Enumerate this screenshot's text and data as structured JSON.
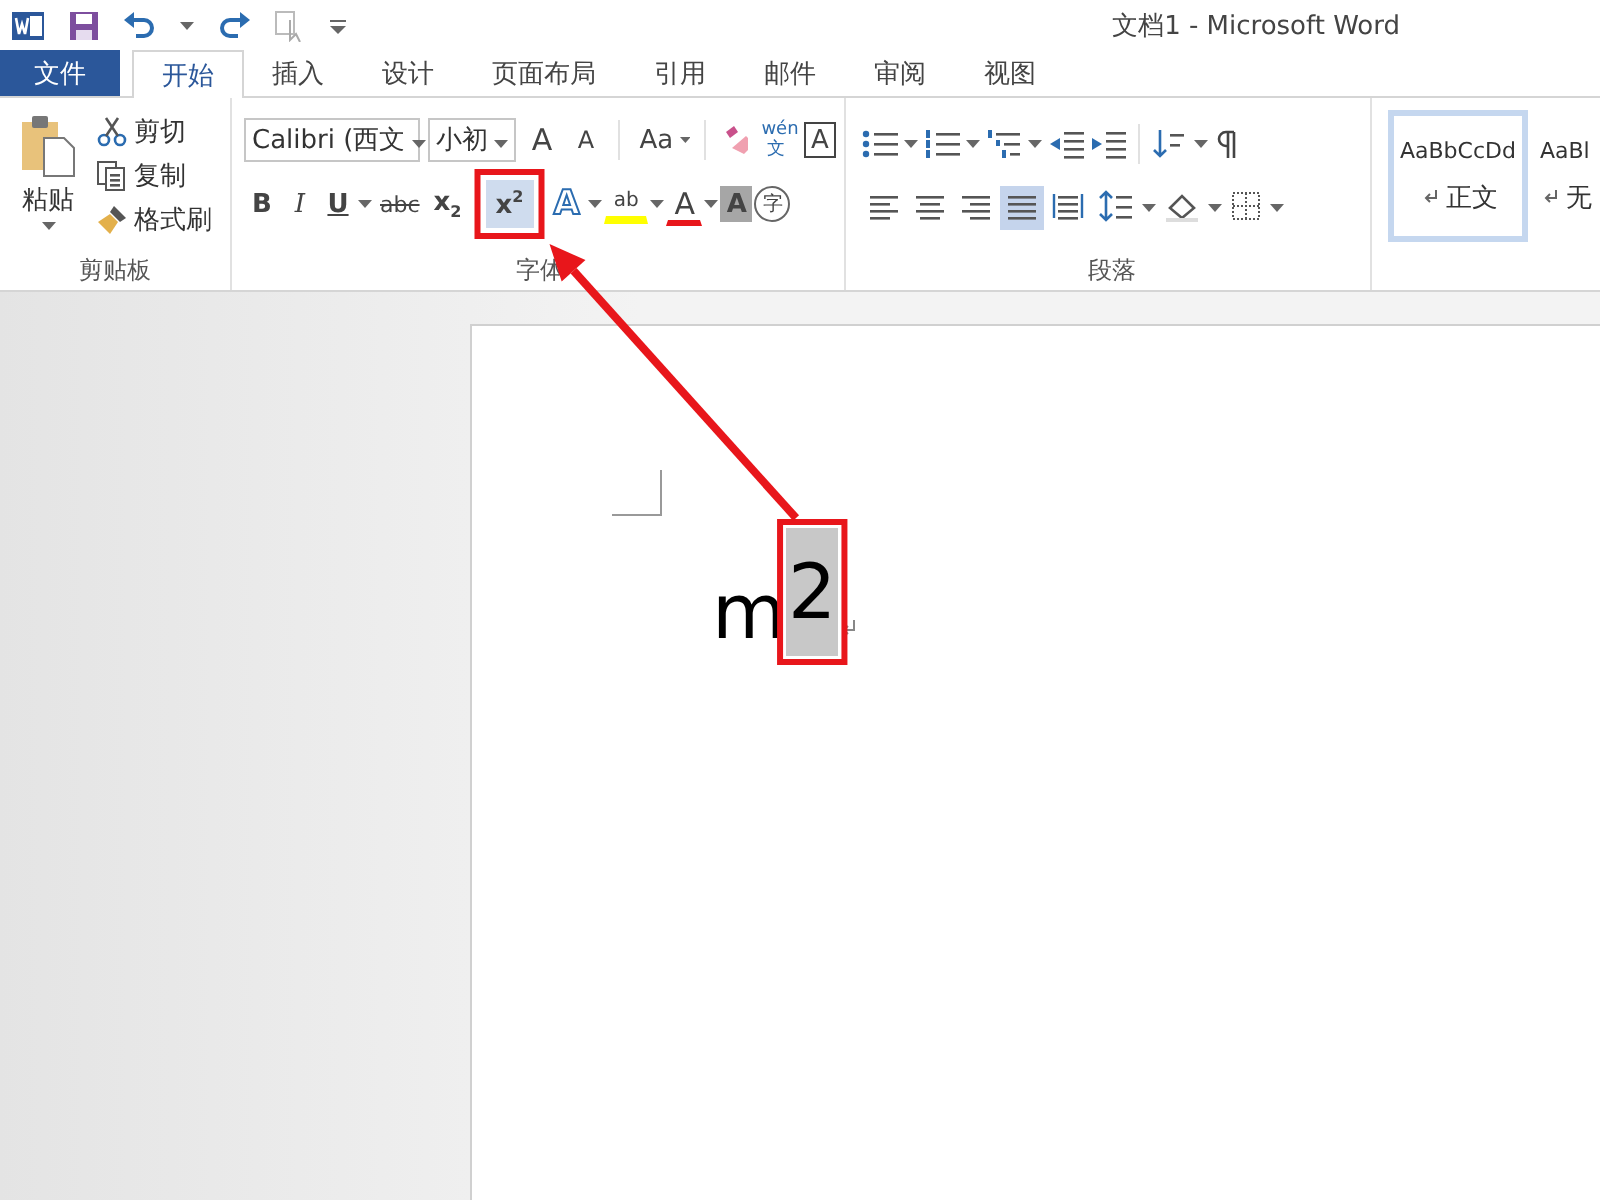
{
  "window": {
    "title": "文档1 - Microsoft Word"
  },
  "tabs": [
    {
      "label": "文件",
      "kind": "file",
      "selected": false
    },
    {
      "label": "开始",
      "kind": "tab",
      "selected": true
    },
    {
      "label": "插入",
      "kind": "tab",
      "selected": false
    },
    {
      "label": "设计",
      "kind": "tab",
      "selected": false
    },
    {
      "label": "页面布局",
      "kind": "tab",
      "selected": false
    },
    {
      "label": "引用",
      "kind": "tab",
      "selected": false
    },
    {
      "label": "邮件",
      "kind": "tab",
      "selected": false
    },
    {
      "label": "审阅",
      "kind": "tab",
      "selected": false
    },
    {
      "label": "视图",
      "kind": "tab",
      "selected": false
    }
  ],
  "clipboard": {
    "paste": "粘贴",
    "items": [
      {
        "kind": "cut",
        "label": "剪切"
      },
      {
        "kind": "copy",
        "label": "复制"
      },
      {
        "kind": "painter",
        "label": "格式刷"
      }
    ],
    "label": "剪贴板"
  },
  "font": {
    "name": "Calibri (西文",
    "size": "小初",
    "label": "字体",
    "row1": [
      {
        "kind": "grow",
        "label": "A"
      },
      {
        "kind": "shrink",
        "label": "A"
      },
      {
        "kind": "case",
        "label": "Aa"
      },
      {
        "kind": "clear"
      },
      {
        "kind": "phonetic",
        "label": "wén",
        "sub": "文"
      },
      {
        "kind": "border",
        "label": "A"
      }
    ],
    "row2": [
      {
        "kind": "bold",
        "label": "B",
        "selected": false
      },
      {
        "kind": "italic",
        "label": "I",
        "selected": false
      },
      {
        "kind": "underline",
        "label": "U",
        "selected": false
      },
      {
        "kind": "strike",
        "label": "abc",
        "selected": false
      },
      {
        "kind": "subscript",
        "label": "x$_{2}$",
        "selected": false
      },
      {
        "kind": "superscript",
        "label": "x$^{2}$",
        "selected": true
      },
      {
        "kind": "effects",
        "label": "A",
        "selected": false
      },
      {
        "kind": "highlight",
        "label": "ab",
        "selected": false
      },
      {
        "kind": "color",
        "label": "A",
        "selected": false
      },
      {
        "kind": "shading",
        "label": "A",
        "selected": false
      },
      {
        "kind": "enclose",
        "label": "字",
        "selected": false
      }
    ]
  },
  "paragraph": {
    "label": "段落",
    "row1": [
      {
        "kind": "bullets"
      },
      {
        "kind": "numbering"
      },
      {
        "kind": "multilevel"
      },
      {
        "kind": "outdent"
      },
      {
        "kind": "indent"
      },
      {
        "kind": "sort"
      },
      {
        "kind": "marks"
      }
    ],
    "row2": [
      {
        "kind": "left",
        "selected": false
      },
      {
        "kind": "center",
        "selected": false
      },
      {
        "kind": "right",
        "selected": false
      },
      {
        "kind": "justify",
        "selected": true
      },
      {
        "kind": "distributed",
        "selected": false
      },
      {
        "kind": "spacing",
        "selected": false
      },
      {
        "kind": "fill",
        "selected": false
      },
      {
        "kind": "borders",
        "selected": false
      }
    ]
  },
  "styles": [
    {
      "preview": "AaBbCcDd",
      "name": "正文",
      "selected": true
    },
    {
      "preview": "AaBl",
      "name": "无",
      "selected": false
    }
  ],
  "document": {
    "text": "m",
    "selected_text": "2"
  }
}
